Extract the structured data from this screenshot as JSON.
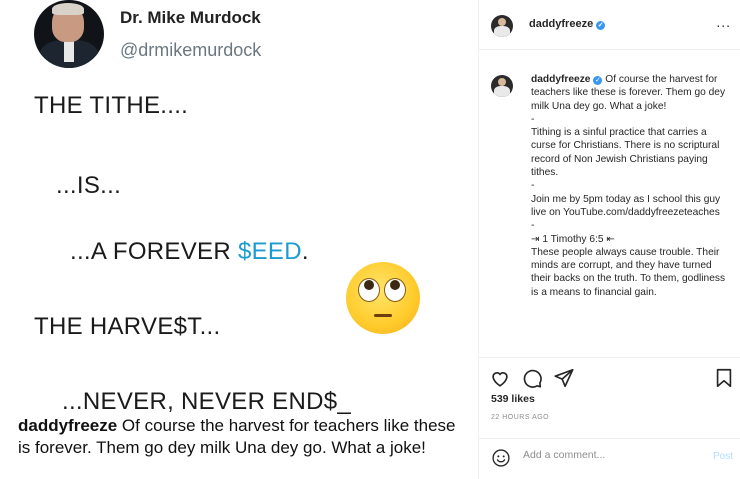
{
  "image": {
    "tweet_name": "Dr. Mike Murdock",
    "tweet_handle": "@drmikemurdock",
    "line1": "THE TITHE....",
    "line2": "...IS...",
    "line3_prefix": "...A FOREVER ",
    "line3_seed": "$EED",
    "line3_suffix": ".",
    "line4": "THE HARVE$T...",
    "line5": "...NEVER, NEVER END$_",
    "caption_user": "daddyfreeze",
    "caption_text": " Of course the harvest for teachers like these is forever. Them go dey milk Una dey go. What a joke!"
  },
  "header": {
    "username": "daddyfreeze",
    "verified_icon": "✓",
    "more_label": "..."
  },
  "comment": {
    "username": "daddyfreeze",
    "verified_icon": "✓",
    "p1": " Of course the harvest for teachers like these is forever. Them go dey milk Una dey go. What a joke!",
    "d1": "-",
    "p2": "Tithing is a sinful practice that carries a curse for Christians. There is no scriptural record of Non Jewish Christians paying tithes.",
    "d2": "-",
    "p3": "Join me by 5pm today as I school this guy live on YouTube.com/daddyfreezeteaches",
    "d3": "-",
    "p4": "⇥ 1 Timothy 6:5 ⇤",
    "p5": "These people always cause trouble. Their minds are corrupt, and they have turned their backs on the truth. To them, godliness is a means to financial gain."
  },
  "stats": {
    "likes": "539 likes",
    "time_ago": "22 HOURS AGO"
  },
  "add_comment": {
    "placeholder": "Add a comment...",
    "post_label": "Post"
  },
  "colors": {
    "accent_seed": "#1d9bd1",
    "verified": "#3897f0",
    "post_disabled": "#b3dbff"
  }
}
